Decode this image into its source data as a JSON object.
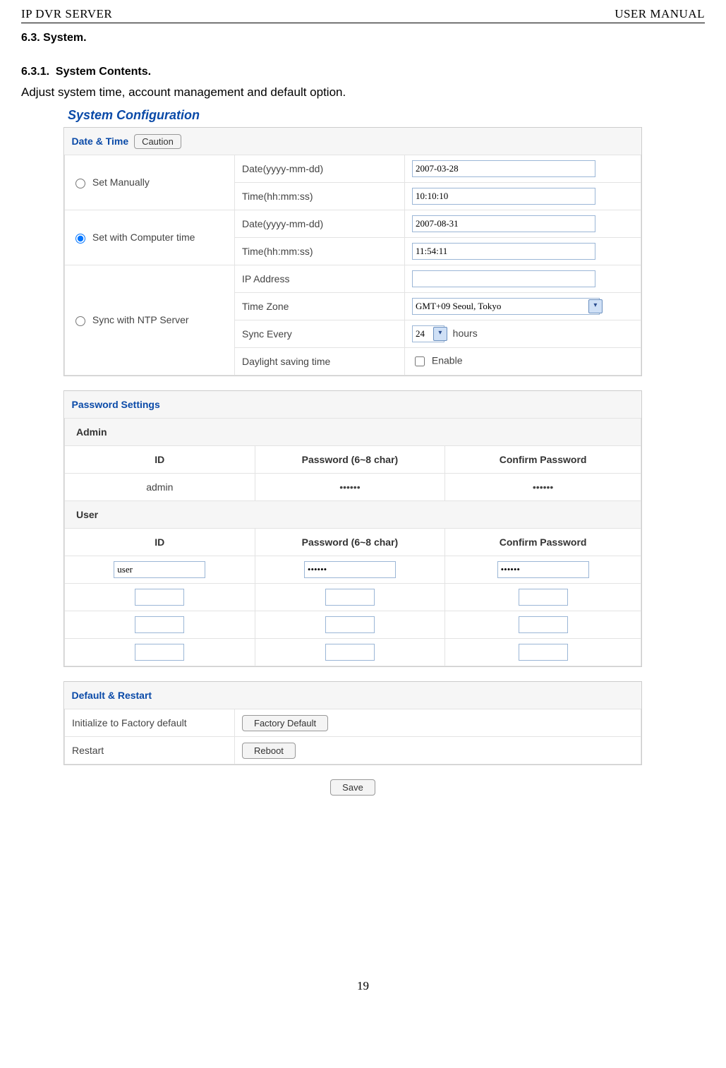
{
  "header": {
    "left": "IP DVR SERVER",
    "right": "USER MANUAL"
  },
  "sec63": {
    "num": "6.3.",
    "title": "System."
  },
  "sec631": {
    "num": "6.3.1.",
    "title": "System Contents."
  },
  "desc": "Adjust system time, account management and default option.",
  "sysconf_title": "System Configuration",
  "datetime": {
    "title": "Date & Time",
    "caution_btn": "Caution",
    "set_manually": "Set Manually",
    "date_label": "Date(yyyy-mm-dd)",
    "time_label": "Time(hh:mm:ss)",
    "manual_date": "2007-03-28",
    "manual_time": "10:10:10",
    "set_computer": "Set with Computer time",
    "comp_date": "2007-08-31",
    "comp_time": "11:54:11",
    "sync_ntp": "Sync with NTP Server",
    "ip_label": "IP Address",
    "ip_value": "",
    "tz_label": "Time Zone",
    "tz_value": "GMT+09 Seoul, Tokyo",
    "sync_every_label": "Sync Every",
    "sync_every_value": "24",
    "hours": "hours",
    "dst_label": "Daylight saving time",
    "dst_enable": "Enable"
  },
  "pw": {
    "title": "Password Settings",
    "admin": "Admin",
    "user": "User",
    "id": "ID",
    "pwlabel": "Password (6~8 char)",
    "confirm": "Confirm Password",
    "admin_id": "admin",
    "admin_pw": "••••••",
    "admin_cf": "••••••",
    "users": [
      {
        "id": "user",
        "pw": "••••••",
        "cf": "••••••"
      },
      {
        "id": "",
        "pw": "",
        "cf": ""
      },
      {
        "id": "",
        "pw": "",
        "cf": ""
      },
      {
        "id": "",
        "pw": "",
        "cf": ""
      }
    ]
  },
  "def": {
    "title": "Default & Restart",
    "init_label": "Initialize to Factory default",
    "init_btn": "Factory Default",
    "restart_label": "Restart",
    "restart_btn": "Reboot"
  },
  "save": "Save",
  "page_num": "19"
}
